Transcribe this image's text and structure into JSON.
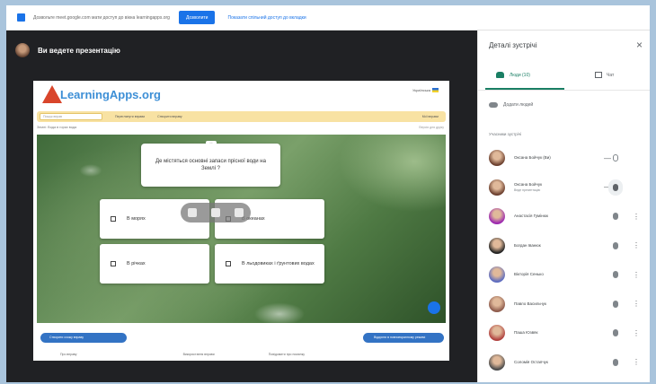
{
  "top_bar": {
    "message": "Дозвольте meet.google.com мати доступ до вікна learningapps.org",
    "allow_label": "Дозволити",
    "link_label": "Показати спільний доступ до вкладки"
  },
  "presentation": {
    "title": "Ви ведете презентацію",
    "site": {
      "brand": "LearningApps.org",
      "language": "Українська",
      "search_placeholder": "Пошук вправ",
      "toolbar_items": [
        "Переглянути вправи",
        "Створити вправу"
      ],
      "toolbar_right": "Мої вправи",
      "breadcrumb": "Землі: Вода в горах вода",
      "breadcrumb_right": "Версія для друку"
    },
    "quiz": {
      "question": "Де містяться основні запаси прісної води на Землі ?",
      "answers": [
        "В морях",
        "В океанах",
        "В річках",
        "В льодовиках і ґрунтових водах"
      ]
    },
    "bottom_left": "Створити схожу вправу",
    "bottom_right": "Відкрити в повноекранному режимі",
    "footer": [
      "Про вправу",
      "Використання вправи",
      "Повідомити про помилку"
    ]
  },
  "panel": {
    "title": "Деталі зустрічі",
    "close_label": "×",
    "tabs": {
      "people": "Люди (10)",
      "chat": "Чат"
    },
    "add_people": "Додати людей",
    "section_label": "Учасники зустрічі",
    "participants": [
      {
        "name": "Оксана Бойчук (Ви)",
        "sub": "",
        "color": "#6b3f2e"
      },
      {
        "name": "Оксана Бойчук",
        "sub": "Веде презентацію",
        "color": "#6b3f2e"
      },
      {
        "name": "Анастасія Гумінюк",
        "sub": "",
        "color": "#9c27b0"
      },
      {
        "name": "Богдан Іванюк",
        "sub": "",
        "color": "#222222"
      },
      {
        "name": "Вікторія Сенько",
        "sub": "",
        "color": "#5c6bc0"
      },
      {
        "name": "Павло Васильчук",
        "sub": "",
        "color": "#8e5b4c"
      },
      {
        "name": "Паша Юзвяк",
        "sub": "",
        "color": "#b0413e"
      },
      {
        "name": "Соломія Остапчук",
        "sub": "",
        "color": "#4a4a4a"
      }
    ]
  }
}
